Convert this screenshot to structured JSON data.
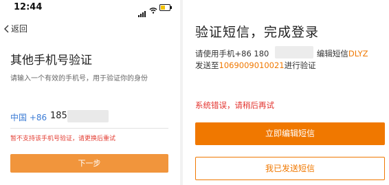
{
  "left": {
    "status_time": "12:44",
    "back_label": "返回",
    "title": "其他手机号验证",
    "subtitle": "请输入一个有效的手机号，用于验证你的身份",
    "country_code": "中国 +86",
    "phone_prefix": "185",
    "error": "暂不支持该手机号验证，请更换后重试",
    "next_button": "下一步"
  },
  "right": {
    "title": "验证短信，完成登录",
    "instr_prefix": "请使用手机+86 180",
    "instr_mid": "，编辑短信",
    "sms_code": "DLYZ",
    "send_to_label": "发送至",
    "send_number": "1069009010021",
    "send_suffix": "进行验证",
    "error": "系统错误，请稍后再试",
    "edit_button": "立即编辑短信",
    "sent_button": "我已发送短信"
  },
  "colors": {
    "accent": "#f07800",
    "error": "#e33e33",
    "link": "#3a7bd5"
  },
  "icons": [
    "signal-icon",
    "wifi-icon",
    "battery-icon",
    "chevron-left-icon"
  ]
}
